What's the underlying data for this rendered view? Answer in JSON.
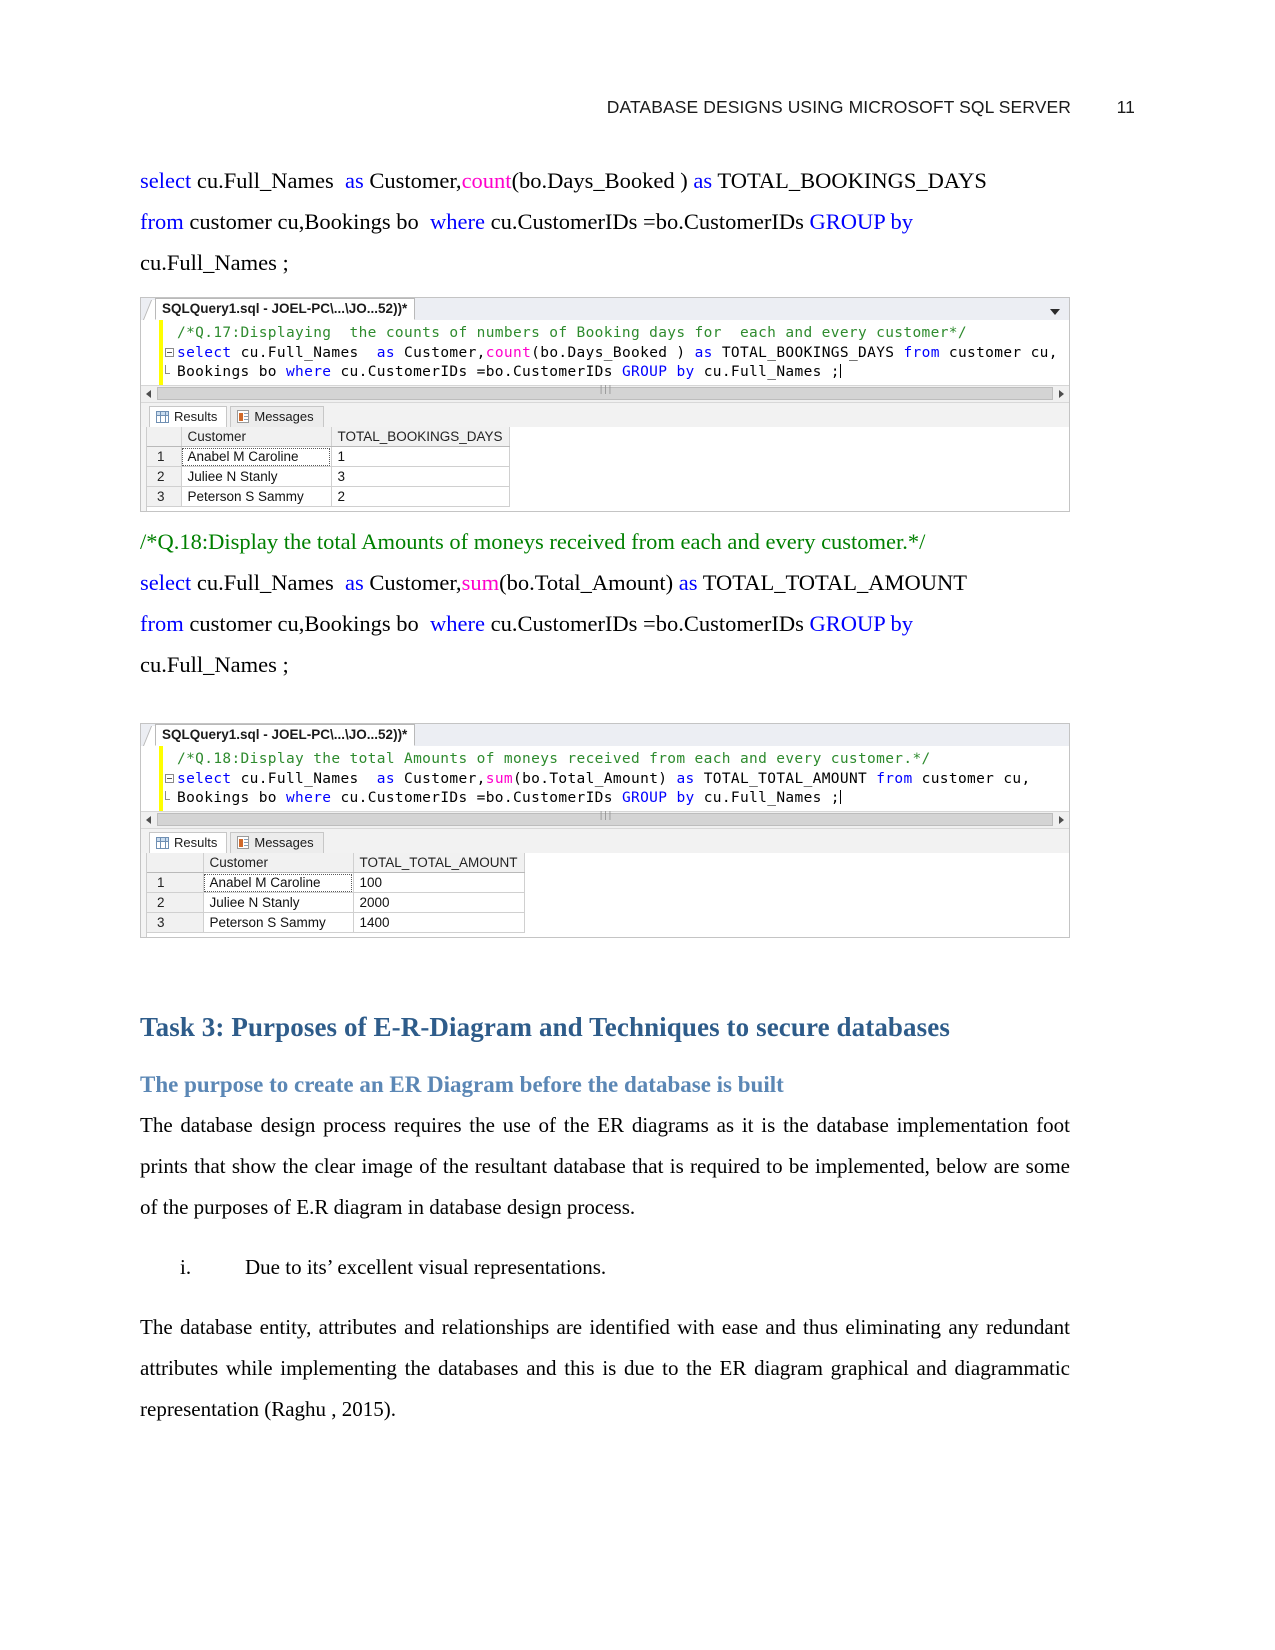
{
  "header": {
    "title": "DATABASE DESIGNS USING MICROSOFT SQL SERVER",
    "page_number": "11"
  },
  "q17": {
    "doc_code": {
      "line1_a": "select ",
      "line1_b": "cu.Full_Names  ",
      "line1_c": "as ",
      "line1_d": "Customer,",
      "line1_e": "count",
      "line1_f": "(bo.Days_Booked ) ",
      "line1_g": "as ",
      "line1_h": "TOTAL_BOOKINGS_DAYS",
      "line2_a": "from ",
      "line2_b": "customer cu,Bookings bo  ",
      "line2_c": "where ",
      "line2_d": "cu.CustomerIDs =bo.CustomerIDs ",
      "line2_e": "GROUP by",
      "line3_a": "cu.Full_Names ;"
    },
    "window": {
      "tab_label": "SQLQuery1.sql - JOEL-PC\\...\\JO...52))*",
      "editor": {
        "line1_comment": "/*Q.17:Displaying  the counts of numbers of Booking days for  each and every customer*/",
        "line2_k1": "select",
        "line2_t1": " cu.Full_Names  ",
        "line2_k2": "as",
        "line2_t2": " Customer,",
        "line2_m1": "count",
        "line2_t3": "(bo.Days_Booked ) ",
        "line2_k3": "as",
        "line2_t4": " TOTAL_BOOKINGS_DAYS ",
        "line2_k4": "from",
        "line2_t5": " customer cu,",
        "line3_t1": "Bookings bo ",
        "line3_k1": "where",
        "line3_t2": " cu.CustomerIDs =bo.CustomerIDs ",
        "line3_k2": "GROUP",
        "line3_t3": " ",
        "line3_k3": "by",
        "line3_t4": " cu.Full_Names ;"
      },
      "results_tab": "Results",
      "messages_tab": "Messages",
      "grid": {
        "columns": [
          "",
          "Customer",
          "TOTAL_BOOKINGS_DAYS"
        ],
        "rows": [
          [
            "1",
            "Anabel M Caroline",
            "1"
          ],
          [
            "2",
            "Juliee N Stanly",
            "3"
          ],
          [
            "3",
            "Peterson S Sammy",
            "2"
          ]
        ]
      }
    }
  },
  "q18": {
    "doc_code": {
      "comment": "/*Q.18:Display the total Amounts of moneys received from each and every customer.*/",
      "line1_a": "select ",
      "line1_b": "cu.Full_Names  ",
      "line1_c": "as ",
      "line1_d": "Customer,",
      "line1_e": "sum",
      "line1_f": "(bo.Total_Amount) ",
      "line1_g": "as ",
      "line1_h": "TOTAL_TOTAL_AMOUNT",
      "line2_a": "from ",
      "line2_b": "customer cu,Bookings bo  ",
      "line2_c": "where ",
      "line2_d": "cu.CustomerIDs =bo.CustomerIDs ",
      "line2_e": "GROUP by",
      "line3_a": "cu.Full_Names ;"
    },
    "window": {
      "tab_label": "SQLQuery1.sql - JOEL-PC\\...\\JO...52))*",
      "editor": {
        "line1_comment": "/*Q.18:Display the total Amounts of moneys received from each and every customer.*/",
        "line2_k1": "select",
        "line2_t1": " cu.Full_Names  ",
        "line2_k2": "as",
        "line2_t2": " Customer,",
        "line2_m1": "sum",
        "line2_t3": "(bo.Total_Amount) ",
        "line2_k3": "as",
        "line2_t4": " TOTAL_TOTAL_AMOUNT ",
        "line2_k4": "from",
        "line2_t5": " customer cu,",
        "line3_t1": "Bookings bo ",
        "line3_k1": "where",
        "line3_t2": " cu.CustomerIDs =bo.CustomerIDs ",
        "line3_k2": "GROUP",
        "line3_t3": " ",
        "line3_k3": "by",
        "line3_t4": " cu.Full_Names ;"
      },
      "results_tab": "Results",
      "messages_tab": "Messages",
      "grid": {
        "columns": [
          "",
          "Customer",
          "TOTAL_TOTAL_AMOUNT"
        ],
        "rows": [
          [
            "1",
            "Anabel M Caroline",
            "100"
          ],
          [
            "2",
            "Juliee N Stanly",
            "2000"
          ],
          [
            "3",
            "Peterson S Sammy",
            "1400"
          ]
        ]
      }
    }
  },
  "task3": {
    "heading": "Task 3: Purposes of E-R-Diagram and Techniques to secure databases",
    "subheading": "The purpose to create an ER Diagram before the database is built",
    "paragraph1": "The database design process requires the use of the ER diagrams as it is the database implementation foot prints that show the clear image of the resultant database that is required to be implemented, below are some of the purposes of E.R diagram in database design process.",
    "list": [
      {
        "marker": "i.",
        "text": "Due to its’ excellent visual representations."
      }
    ],
    "paragraph2": "The database entity, attributes and relationships are identified with ease and thus eliminating any redundant attributes while implementing the databases and this is due to the ER diagram graphical and diagrammatic representation (Raghu , 2015)."
  },
  "colors": {
    "keyword_blue": "#0000ff",
    "function_pink": "#ff00cc",
    "comment_green": "#008000",
    "heading_dark_blue": "#2e5c8a",
    "subheading_blue": "#5b87b5"
  }
}
